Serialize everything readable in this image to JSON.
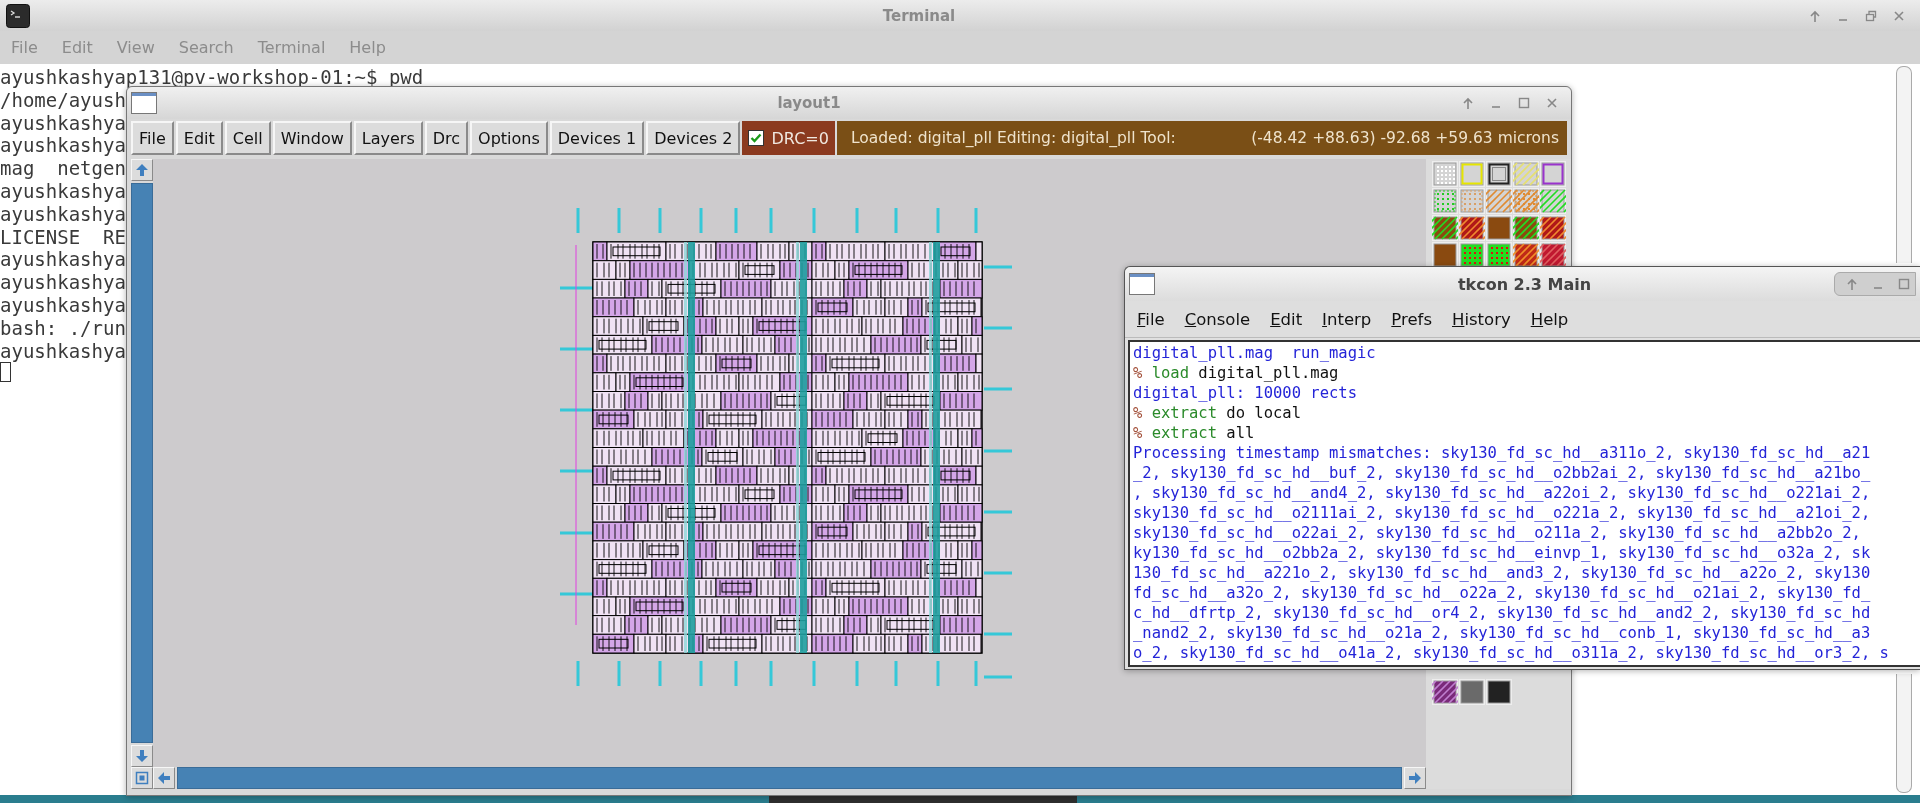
{
  "terminal": {
    "title": "Terminal",
    "menu": [
      "File",
      "Edit",
      "View",
      "Search",
      "Terminal",
      "Help"
    ],
    "lines": [
      "ayushkashyap131@pv-workshop-01:~$ pwd",
      "/home/ayush",
      "ayushkashya",
      "ayushkashya",
      "mag  netgen",
      "ayushkashya",
      "ayushkashya",
      "LICENSE  RE",
      "ayushkashya",
      "ayushkashya",
      "ayushkashya",
      "bash: ./run",
      "ayushkashya"
    ]
  },
  "layout_window": {
    "title": "layout1",
    "toolbar": [
      "File",
      "Edit",
      "Cell",
      "Window",
      "Layers",
      "Drc",
      "Options",
      "Devices 1",
      "Devices 2"
    ],
    "drc": {
      "label": "DRC=0",
      "checked": true
    },
    "status": "Loaded: digital_pll Editing: digital_pll Tool:",
    "coordinates": "(-48.42 +88.63) -92.68 +59.63 microns"
  },
  "tkcon": {
    "title": "tkcon 2.3 Main",
    "menu": [
      "File",
      "Console",
      "Edit",
      "Interp",
      "Prefs",
      "History",
      "Help"
    ],
    "console": [
      {
        "segments": [
          {
            "kind": "output",
            "text": "digital_pll.mag  run_magic"
          }
        ]
      },
      {
        "segments": [
          {
            "kind": "prompt",
            "text": "%"
          },
          {
            "kind": "command",
            "text": "load"
          },
          {
            "kind": "arg",
            "text": "digital_pll.mag"
          }
        ]
      },
      {
        "segments": [
          {
            "kind": "output",
            "text": "digital_pll: 10000 rects"
          }
        ]
      },
      {
        "segments": [
          {
            "kind": "prompt",
            "text": "%"
          },
          {
            "kind": "command",
            "text": "extract"
          },
          {
            "kind": "arg",
            "text": "do local"
          }
        ]
      },
      {
        "segments": [
          {
            "kind": "prompt",
            "text": "%"
          },
          {
            "kind": "command",
            "text": "extract"
          },
          {
            "kind": "arg",
            "text": "all"
          }
        ]
      },
      {
        "segments": [
          {
            "kind": "output",
            "text": "Processing timestamp mismatches: sky130_fd_sc_hd__a311o_2, sky130_fd_sc_hd__a21"
          }
        ]
      },
      {
        "segments": [
          {
            "kind": "output",
            "text": "_2, sky130_fd_sc_hd__buf_2, sky130_fd_sc_hd__o2bb2ai_2, sky130_fd_sc_hd__a21bo_"
          }
        ]
      },
      {
        "segments": [
          {
            "kind": "output",
            "text": ", sky130_fd_sc_hd__and4_2, sky130_fd_sc_hd__a22oi_2, sky130_fd_sc_hd__o221ai_2,"
          }
        ]
      },
      {
        "segments": [
          {
            "kind": "output",
            "text": "sky130_fd_sc_hd__o2111ai_2, sky130_fd_sc_hd__o221a_2, sky130_fd_sc_hd__a21oi_2,"
          }
        ]
      },
      {
        "segments": [
          {
            "kind": "output",
            "text": "sky130_fd_sc_hd__o22ai_2, sky130_fd_sc_hd__o211a_2, sky130_fd_sc_hd__a2bb2o_2,"
          }
        ]
      },
      {
        "segments": [
          {
            "kind": "output",
            "text": "ky130_fd_sc_hd__o2bb2a_2, sky130_fd_sc_hd__einvp_1, sky130_fd_sc_hd__o32a_2, sk"
          }
        ]
      },
      {
        "segments": [
          {
            "kind": "output",
            "text": "130_fd_sc_hd__a221o_2, sky130_fd_sc_hd__and3_2, sky130_fd_sc_hd__a22o_2, sky130"
          }
        ]
      },
      {
        "segments": [
          {
            "kind": "output",
            "text": "fd_sc_hd__a32o_2, sky130_fd_sc_hd__o22a_2, sky130_fd_sc_hd__o21ai_2, sky130_fd_"
          }
        ]
      },
      {
        "segments": [
          {
            "kind": "output",
            "text": "c_hd__dfrtp_2, sky130_fd_sc_hd__or4_2, sky130_fd_sc_hd__and2_2, sky130_fd_sc_hd"
          }
        ]
      },
      {
        "segments": [
          {
            "kind": "output",
            "text": "_nand2_2, sky130_fd_sc_hd__o21a_2, sky130_fd_sc_hd__conb_1, sky130_fd_sc_hd__a3"
          }
        ]
      },
      {
        "segments": [
          {
            "kind": "output",
            "text": "o_2, sky130_fd_sc_hd__o41a_2, sky130_fd_sc_hd__o311a_2, sky130_fd_sc_hd__or3_2, s"
          }
        ]
      }
    ]
  }
}
